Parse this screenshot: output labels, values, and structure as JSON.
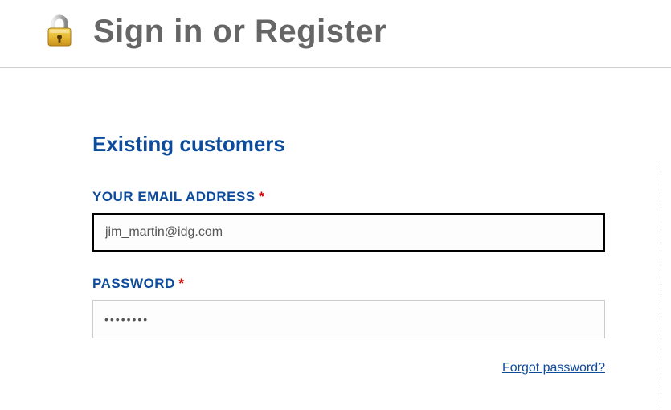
{
  "header": {
    "title": "Sign in or Register"
  },
  "section": {
    "title": "Existing customers"
  },
  "form": {
    "email": {
      "label": "YOUR EMAIL ADDRESS",
      "required": "*",
      "value": "jim_martin@idg.com"
    },
    "password": {
      "label": "PASSWORD",
      "required": "*",
      "value": "••••••••"
    },
    "forgot_link": "Forgot password?"
  }
}
